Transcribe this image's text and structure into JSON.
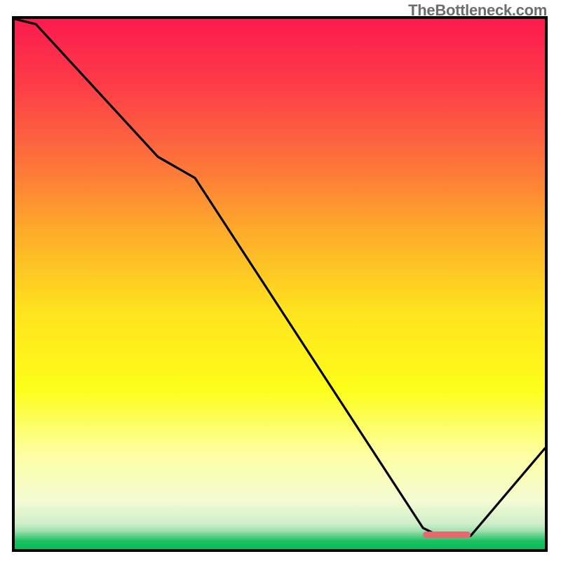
{
  "watermark": "TheBottleneck.com",
  "chart_data": {
    "type": "line",
    "title": "",
    "xlabel": "",
    "ylabel": "",
    "xlim": [
      0,
      100
    ],
    "ylim": [
      0,
      100
    ],
    "x": [
      0,
      4,
      27,
      34,
      77,
      80,
      86,
      100
    ],
    "values": [
      100,
      99,
      74,
      70,
      4,
      2.5,
      2.5,
      19
    ],
    "optimum_band": {
      "x_start": 77,
      "x_end": 86,
      "y": 2.7,
      "thickness": 1.2,
      "color": "#e46a6f"
    },
    "background_gradient": [
      {
        "pos": 0.0,
        "color": "#fc1b4e"
      },
      {
        "pos": 0.12,
        "color": "#fd3b48"
      },
      {
        "pos": 0.25,
        "color": "#fd6a3d"
      },
      {
        "pos": 0.4,
        "color": "#feab2b"
      },
      {
        "pos": 0.55,
        "color": "#ffe31e"
      },
      {
        "pos": 0.7,
        "color": "#fdfe1a"
      },
      {
        "pos": 0.82,
        "color": "#fdffa1"
      },
      {
        "pos": 0.91,
        "color": "#f3fbd3"
      },
      {
        "pos": 0.952,
        "color": "#cfeec9"
      },
      {
        "pos": 0.965,
        "color": "#a5e2b4"
      },
      {
        "pos": 0.975,
        "color": "#5fcf88"
      },
      {
        "pos": 0.985,
        "color": "#1bc164"
      },
      {
        "pos": 1.0,
        "color": "#07bb59"
      }
    ]
  }
}
